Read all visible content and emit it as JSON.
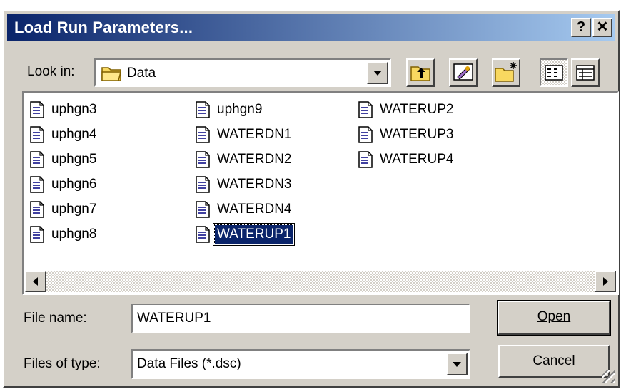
{
  "window": {
    "title": "Load Run Parameters...",
    "help_label": "?",
    "close_label": "✕"
  },
  "lookin": {
    "label": "Look in:",
    "label_mnemonic": "i",
    "value": "Data"
  },
  "toolbar": {
    "icons": [
      "up-one-level-icon",
      "desktop-icon",
      "create-new-folder-icon",
      "list-view-icon",
      "details-view-icon"
    ]
  },
  "files": {
    "columns": [
      [
        "uphgn3",
        "uphgn4",
        "uphgn5",
        "uphgn6",
        "uphgn7",
        "uphgn8"
      ],
      [
        "uphgn9",
        "WATERDN1",
        "WATERDN2",
        "WATERDN3",
        "WATERDN4",
        "WATERUP1"
      ],
      [
        "WATERUP2",
        "WATERUP3",
        "WATERUP4"
      ]
    ],
    "selected": "WATERUP1"
  },
  "filename": {
    "label": "File name:",
    "value": "WATERUP1"
  },
  "filetype": {
    "label": "Files of type:",
    "value": "Data Files (*.dsc)"
  },
  "buttons": {
    "open": "Open",
    "cancel": "Cancel"
  },
  "colors": {
    "title_start": "#0a246a",
    "title_end": "#a6caf0",
    "face": "#d4d0c8",
    "selection": "#0a246a"
  }
}
